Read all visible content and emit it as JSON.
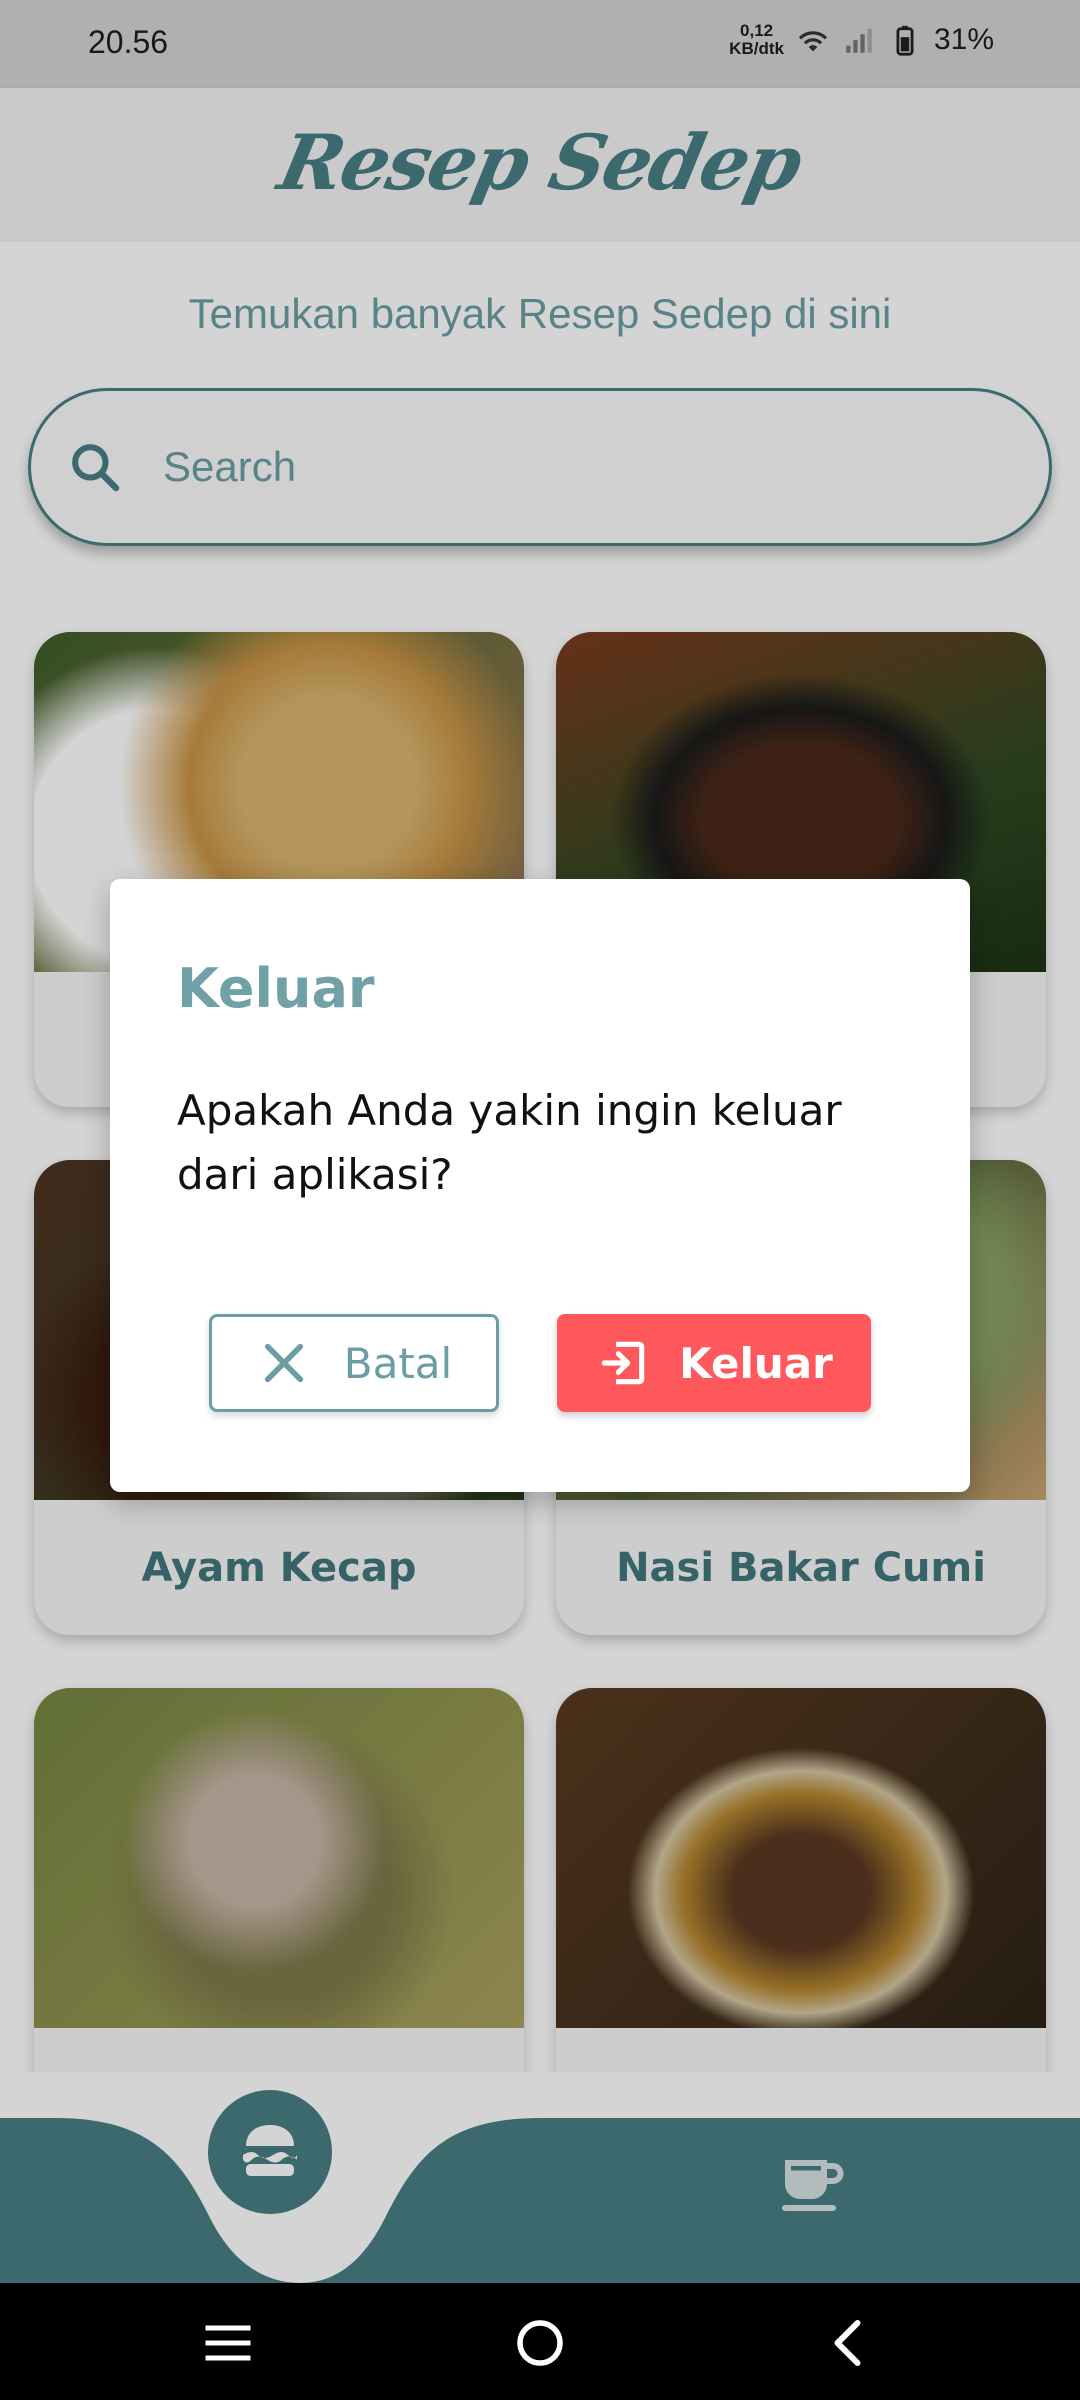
{
  "status_bar": {
    "time": "20.56",
    "net_speed_value": "0,12",
    "net_speed_unit": "KB/dtk",
    "battery": "31%"
  },
  "header": {
    "app_name": "Resep Sedep"
  },
  "home": {
    "tagline": "Temukan banyak Resep Sedep di sini",
    "search_placeholder": "Search"
  },
  "recipes": [
    {
      "title": ""
    },
    {
      "title": ""
    },
    {
      "title": "Ayam Kecap"
    },
    {
      "title": "Nasi Bakar Cumi"
    },
    {
      "title": ""
    },
    {
      "title": ""
    }
  ],
  "bottom_nav": {
    "items": [
      {
        "icon": "hamburger-icon",
        "active": true
      },
      {
        "icon": "coffee-cup-icon",
        "active": false
      }
    ]
  },
  "dialog": {
    "title": "Keluar",
    "message": "Apakah Anda yakin ingin keluar dari aplikasi?",
    "cancel_label": "Batal",
    "confirm_label": "Keluar"
  },
  "colors": {
    "primary": "#497f85",
    "accent_light": "#6a9ea4",
    "danger": "#ff585c"
  }
}
